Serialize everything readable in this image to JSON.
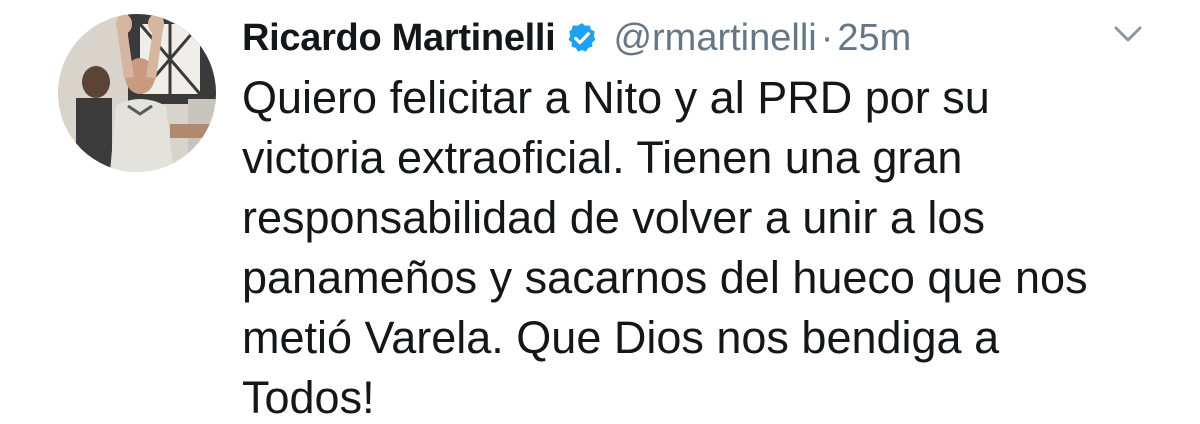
{
  "author": {
    "display_name": "Ricardo Martinelli",
    "handle": "@rmartinelli",
    "separator": "·",
    "timestamp": "25m",
    "verified": true
  },
  "tweet": {
    "lines": [
      "Quiero felicitar a Nito y al PRD por su",
      "victoria extraoficial. Tienen una gran",
      "responsabilidad de volver a unir a los",
      "panameños y sacarnos del hueco que nos",
      "metió Varela. Que Dios nos bendiga a",
      "Todos!"
    ]
  },
  "icons": {
    "verified": "verified-badge-icon",
    "menu": "chevron-down-icon"
  },
  "colors": {
    "text": "#14171a",
    "secondary": "#657786",
    "verified": "#1da1f2",
    "background": "#ffffff"
  }
}
